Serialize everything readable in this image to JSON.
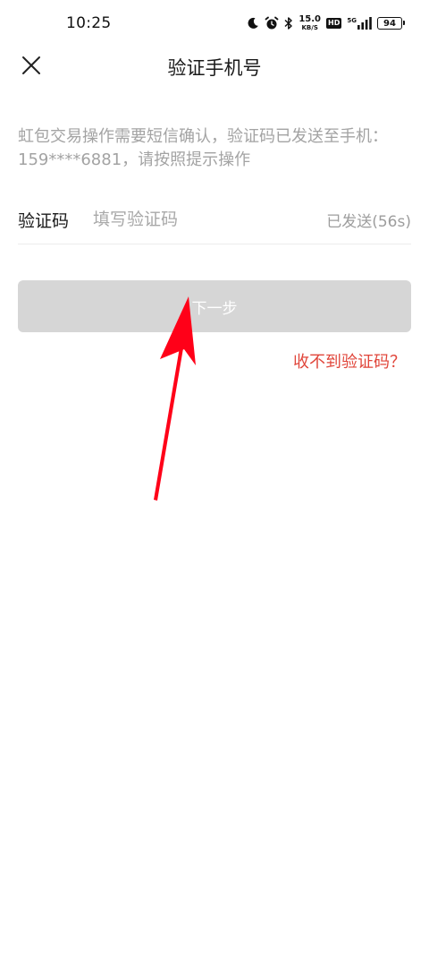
{
  "status_bar": {
    "time": "10:25",
    "net_speed_value": "15.0",
    "net_speed_unit": "KB/S",
    "hd_label": "HD",
    "network_label": "5G",
    "battery_level": "94",
    "icons": [
      "moon-icon",
      "alarm-icon",
      "bluetooth-icon",
      "hd-icon",
      "signal-icon",
      "battery-icon"
    ]
  },
  "header": {
    "title": "验证手机号",
    "close_icon": "close-icon"
  },
  "description": "虹包交易操作需要短信确认，验证码已发送至手机：159****6881，请按照提示操作",
  "code_field": {
    "label": "验证码",
    "placeholder": "填写验证码",
    "value": "",
    "sent_status": "已发送(56s)"
  },
  "next_button": {
    "label": "下一步"
  },
  "no_code_link": {
    "label": "收不到验证码？"
  },
  "colors": {
    "accent_red": "#e0453a",
    "button_disabled": "#d6d6d6",
    "annotation_arrow": "#ff0018"
  }
}
